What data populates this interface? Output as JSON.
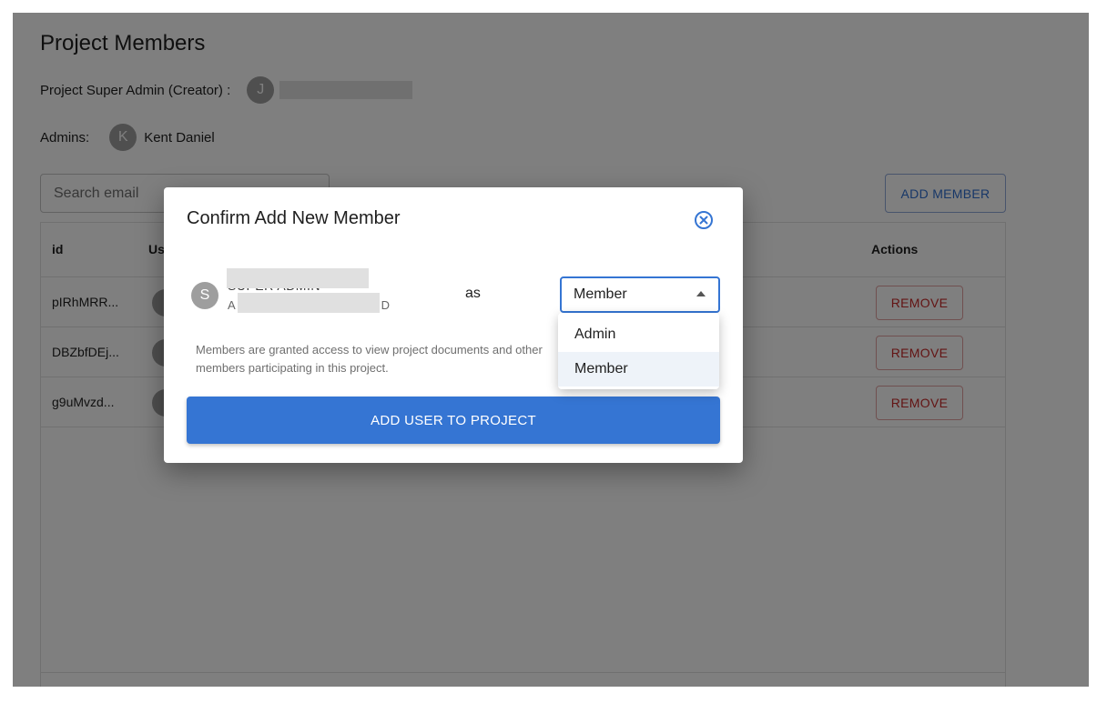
{
  "page": {
    "title": "Project Members",
    "creator_label": "Project Super Admin (Creator) :",
    "creator_initial": "J",
    "admins_label": "Admins:",
    "admins": [
      {
        "initial": "K",
        "name": "Kent Daniel"
      }
    ],
    "search_placeholder": "Search email",
    "add_member_label": "ADD MEMBER"
  },
  "table": {
    "columns": {
      "id": "id",
      "user": "Us",
      "actions": "Actions"
    },
    "rows": [
      {
        "id": "pIRhMRR...",
        "action": "REMOVE"
      },
      {
        "id": "DBZbfDEj...",
        "action": "REMOVE"
      },
      {
        "id": "g9uMvzd...",
        "action": "REMOVE"
      }
    ]
  },
  "modal": {
    "title": "Confirm Add New Member",
    "user_initial": "S",
    "user_name": "SUPER ADMIN",
    "user_id_start": "A",
    "user_id_end": "D",
    "as_label": "as",
    "role_selected": "Member",
    "role_options": [
      "Admin",
      "Member"
    ],
    "help_text": "Members are granted access to view project documents and other members participating in this project.",
    "submit_label": "ADD USER TO PROJECT"
  },
  "colors": {
    "primary": "#3575d3",
    "danger": "#c62828",
    "backdrop": "rgba(0,0,0,0.5)"
  }
}
